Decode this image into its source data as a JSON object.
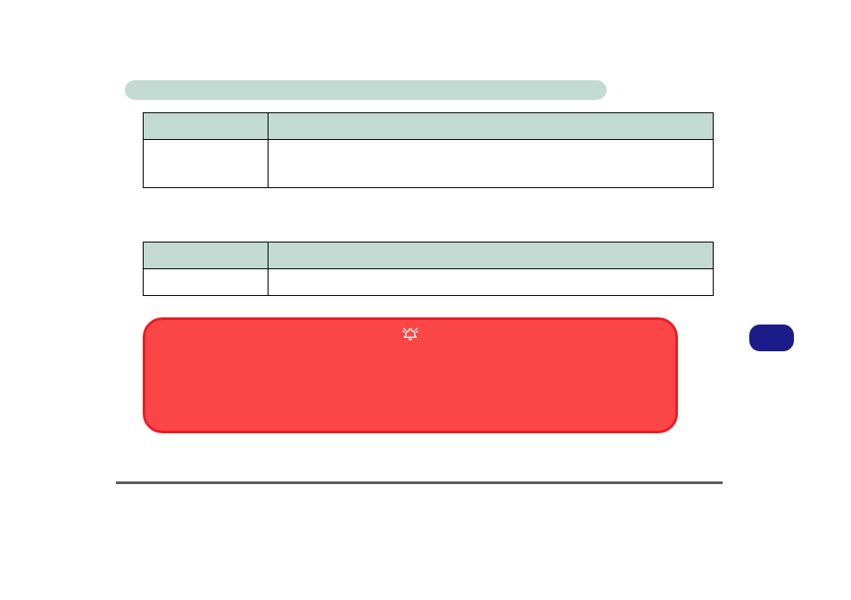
{
  "title_bar": {
    "label": ""
  },
  "table1": {
    "headers": [
      "",
      ""
    ],
    "row": [
      "",
      ""
    ]
  },
  "table2": {
    "headers": [
      "",
      ""
    ],
    "row": [
      "",
      ""
    ]
  },
  "alert": {
    "icon": "bell-icon",
    "text": ""
  },
  "side_pill": {
    "label": ""
  }
}
